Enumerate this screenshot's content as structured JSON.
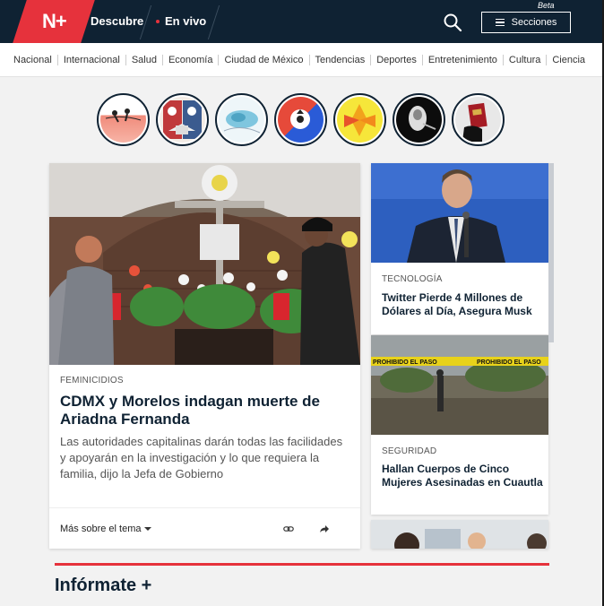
{
  "header": {
    "logo_text": "N+",
    "nav_discover": "Descubre",
    "nav_live": "En vivo",
    "beta_label": "Beta",
    "sections_label": "Secciones",
    "search_icon": "search-icon",
    "menu_icon": "hamburger-icon"
  },
  "categories": [
    "Nacional",
    "Internacional",
    "Salud",
    "Economía",
    "Ciudad de México",
    "Tendencias",
    "Deportes",
    "Entretenimiento",
    "Cultura",
    "Ciencia"
  ],
  "stories": [
    {
      "name": "story-1",
      "colors": [
        "#f08a7a",
        "#f7c6bb"
      ]
    },
    {
      "name": "story-2",
      "colors": [
        "#b83b3b",
        "#3a5a8a"
      ]
    },
    {
      "name": "story-3",
      "colors": [
        "#8fd3e8",
        "#e8f4f8"
      ]
    },
    {
      "name": "story-4",
      "colors": [
        "#2a5bd7",
        "#e64a3a"
      ]
    },
    {
      "name": "story-5",
      "colors": [
        "#f2b31c",
        "#e8542a"
      ]
    },
    {
      "name": "story-6",
      "colors": [
        "#111111",
        "#dddddd"
      ]
    },
    {
      "name": "story-7",
      "colors": [
        "#111111",
        "#a51c24"
      ]
    }
  ],
  "main_article": {
    "kicker": "FEMINICIDIOS",
    "title": "CDMX y Morelos indagan muerte de Ariadna Fernanda",
    "summary": "Las autoridades capitalinas darán todas las facilidades y apoyarán en la investigación y lo que requiera la familia, dijo la Jefa de Gobierno",
    "more_label": "Más sobre el tema"
  },
  "side_articles": [
    {
      "kicker": "TECNOLOGÍA",
      "title": "Twitter Pierde 4 Millones de Dólares al Día, Asegura Musk"
    },
    {
      "kicker": "SEGURIDAD",
      "title": "Hallan Cuerpos de Cinco Mujeres Asesinadas en Cuautla",
      "tape_text": "PROHIBIDO EL PASO"
    }
  ],
  "section": {
    "informate": "Infórmate +"
  },
  "colors": {
    "brand_red": "#e6323c",
    "navy": "#0f2233"
  }
}
